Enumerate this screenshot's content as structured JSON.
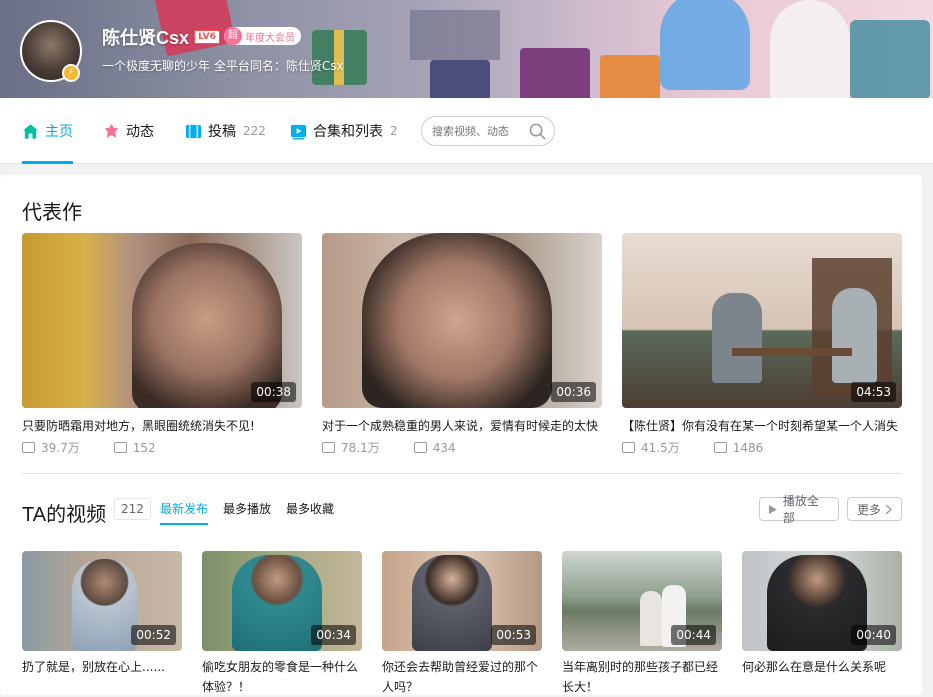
{
  "header": {
    "username": "陈仕贤Csx",
    "level": "LV6",
    "vip_icon": "超",
    "vip_label": "年度大会员",
    "signature": "一个极度无聊的少年 全平台同名：陈仕贤Csx",
    "avatar_badge": "⚡"
  },
  "nav": {
    "tabs": [
      {
        "label": "主页",
        "count": ""
      },
      {
        "label": "动态",
        "count": ""
      },
      {
        "label": "投稿",
        "count": "222"
      },
      {
        "label": "合集和列表",
        "count": "2"
      }
    ],
    "search_placeholder": "搜索视频、动态"
  },
  "representative": {
    "heading": "代表作",
    "items": [
      {
        "title": "只要防晒霜用对地方，黑眼圈统统消失不见!",
        "duration": "00:38",
        "plays": "39.7万",
        "danmaku": "152"
      },
      {
        "title": "对于一个成熟稳重的男人来说，爱情有时候走的太快",
        "duration": "00:36",
        "plays": "78.1万",
        "danmaku": "434"
      },
      {
        "title": "【陈仕贤】你有没有在某一个时刻希望某一个人消失",
        "duration": "04:53",
        "plays": "41.5万",
        "danmaku": "1486"
      }
    ]
  },
  "videos": {
    "heading": "TA的视频",
    "count": "212",
    "sorts": [
      "最新发布",
      "最多播放",
      "最多收藏"
    ],
    "play_all": "播放全部",
    "more": "更多",
    "items": [
      {
        "title": "扔了就是，别放在心上......",
        "duration": "00:52"
      },
      {
        "title": "偷吃女朋友的零食是一种什么体验？！",
        "duration": "00:34"
      },
      {
        "title": "你还会去帮助曾经爱过的那个人吗？",
        "duration": "00:53"
      },
      {
        "title": "当年离别时的那些孩子都已经长大！",
        "duration": "00:44"
      },
      {
        "title": "何必那么在意是什么关系呢",
        "duration": "00:40"
      }
    ]
  },
  "colors": {
    "accent": "#00aeec",
    "vip": "#fb7299",
    "text": "#18191c",
    "muted": "#9499a0"
  }
}
